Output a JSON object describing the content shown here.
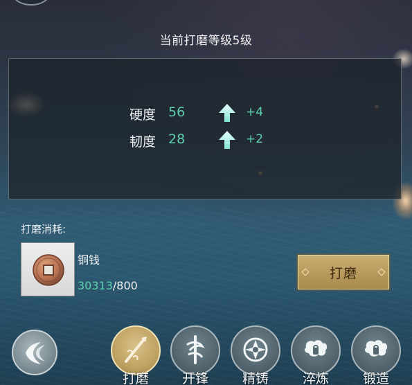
{
  "header": {
    "level_title": "当前打磨等级5级"
  },
  "stats": [
    {
      "name": "硬度",
      "value": "56",
      "increase": "+4",
      "icon": "up-arrow-icon"
    },
    {
      "name": "韧度",
      "value": "28",
      "increase": "+2",
      "icon": "up-arrow-icon"
    }
  ],
  "cost": {
    "label": "打磨消耗:",
    "item_name": "铜钱",
    "item_icon": "copper-coin-icon",
    "owned": "30313",
    "required": "/800"
  },
  "actions": {
    "polish_label": "打磨"
  },
  "tabs": [
    {
      "label": "打磨",
      "icon": "polish-icon",
      "active": true
    },
    {
      "label": "开锋",
      "icon": "sharpen-icon",
      "active": false
    },
    {
      "label": "精铸",
      "icon": "refine-cast-icon",
      "active": false
    },
    {
      "label": "淬炼",
      "icon": "quench-icon",
      "active": false
    },
    {
      "label": "锻造",
      "icon": "forge-icon",
      "active": false
    }
  ],
  "colors": {
    "accent_green": "#5fd0ad",
    "button_gold": "#b79a5b",
    "panel_bg": "#1c222a"
  }
}
